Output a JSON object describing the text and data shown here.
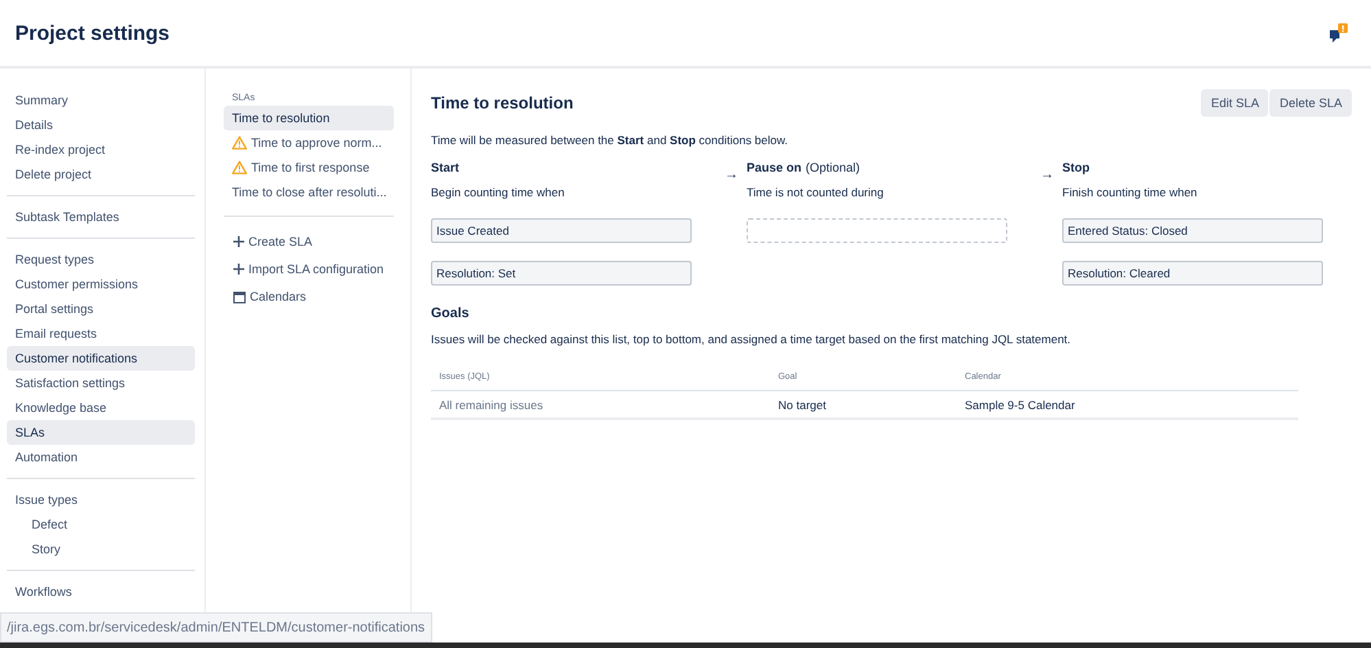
{
  "header": {
    "title": "Project settings"
  },
  "sidebar": {
    "groups": [
      {
        "items": [
          {
            "label": "Summary",
            "selected": false
          },
          {
            "label": "Details",
            "selected": false
          },
          {
            "label": "Re-index project",
            "selected": false
          },
          {
            "label": "Delete project",
            "selected": false
          }
        ]
      },
      {
        "items": [
          {
            "label": "Subtask Templates",
            "selected": false
          }
        ]
      },
      {
        "items": [
          {
            "label": "Request types",
            "selected": false
          },
          {
            "label": "Customer permissions",
            "selected": false
          },
          {
            "label": "Portal settings",
            "selected": false
          },
          {
            "label": "Email requests",
            "selected": false
          },
          {
            "label": "Customer notifications",
            "selected": true
          },
          {
            "label": "Satisfaction settings",
            "selected": false
          },
          {
            "label": "Knowledge base",
            "selected": false
          },
          {
            "label": "SLAs",
            "selected": true
          },
          {
            "label": "Automation",
            "selected": false
          }
        ]
      },
      {
        "items": [
          {
            "label": "Issue types",
            "selected": false,
            "children": [
              {
                "label": "Defect",
                "selected": false
              },
              {
                "label": "Story",
                "selected": false
              }
            ]
          }
        ]
      },
      {
        "items": [
          {
            "label": "Workflows",
            "selected": false
          }
        ]
      }
    ]
  },
  "sla_panel": {
    "heading": "SLAs",
    "slas": [
      {
        "label": "Time to resolution",
        "selected": true,
        "warning": false
      },
      {
        "label": "Time to approve norm...",
        "selected": false,
        "warning": true
      },
      {
        "label": "Time to first response",
        "selected": false,
        "warning": true
      },
      {
        "label": "Time to close after resoluti...",
        "selected": false,
        "warning": false
      }
    ],
    "actions": [
      {
        "label": "Create SLA",
        "kind": "plus"
      },
      {
        "label": "Import SLA configuration",
        "kind": "plus"
      },
      {
        "label": "Calendars",
        "kind": "calendar"
      }
    ]
  },
  "detail": {
    "title": "Time to resolution",
    "buttons": [
      "Edit SLA",
      "Delete SLA"
    ],
    "intro": "Time will be measured between the **Start** and **Stop** conditions below.",
    "arrow": "→",
    "columns": [
      {
        "title": "Start",
        "subtitle": "Begin counting time when",
        "conditions": [
          "Issue Created",
          "Resolution: Set"
        ]
      },
      {
        "title": "Pause on",
        "note": "(Optional)",
        "subtitle": "Time is not counted during"
      },
      {
        "title": "Stop",
        "subtitle": "Finish counting time when",
        "conditions": [
          "Entered Status: Closed",
          "Resolution: Cleared"
        ]
      }
    ],
    "goals": {
      "title": "Goals",
      "description": "Issues will be checked against this list, top to bottom, and assigned a time target based on the first matching JQL statement.",
      "table": {
        "columns": [
          "Issues (JQL)",
          "Goal",
          "Calendar"
        ],
        "rows": [
          [
            "All remaining issues",
            "No target",
            "Sample 9-5 Calendar"
          ]
        ]
      }
    }
  },
  "status_bar": {
    "url": "/jira.egs.com.br/servicedesk/admin/ENTELDM/customer-notifications"
  }
}
